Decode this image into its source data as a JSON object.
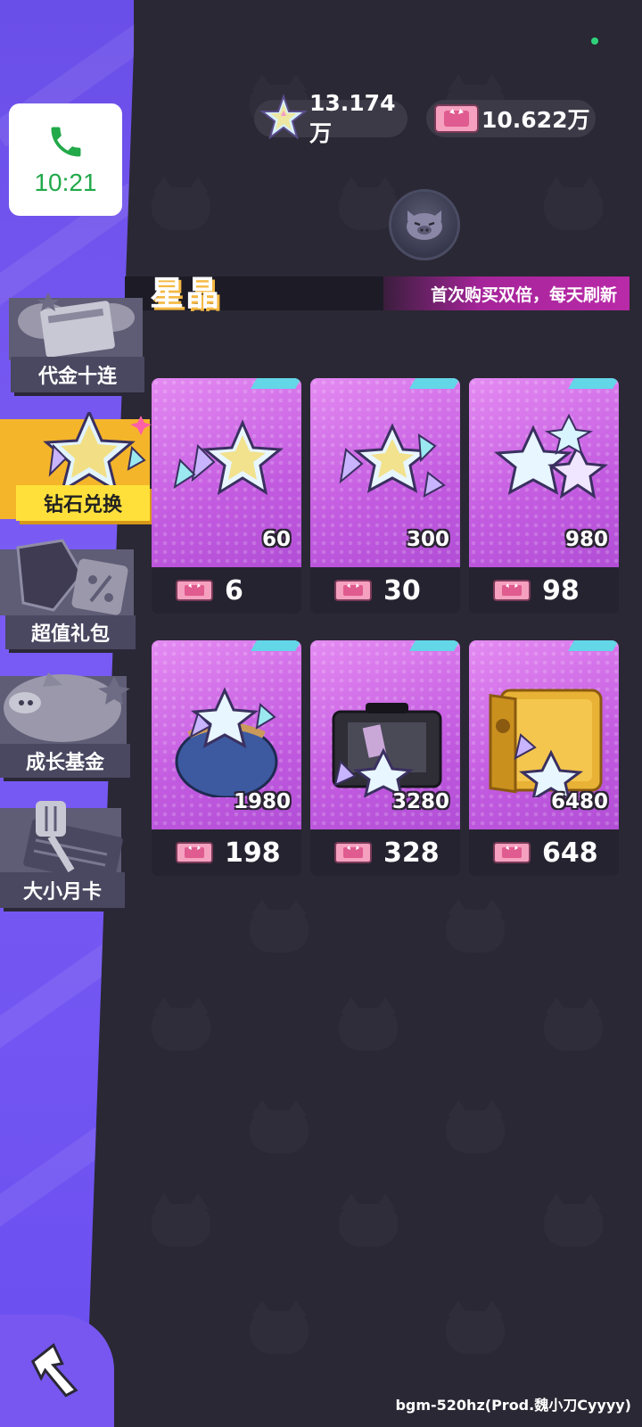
{
  "status": {
    "call_time": "10:21"
  },
  "currencies": {
    "star_crystal": "13.174万",
    "ticket": "10.622万"
  },
  "header": {
    "title": "星晶",
    "tagline": "首次购买双倍，每天刷新"
  },
  "menu": [
    {
      "label": "代金十连",
      "active": false,
      "icon": "coupon-stack-icon"
    },
    {
      "label": "钻石兑换",
      "active": true,
      "icon": "star-crystal-icon"
    },
    {
      "label": "超值礼包",
      "active": false,
      "icon": "gift-bag-icon"
    },
    {
      "label": "成长基金",
      "active": false,
      "icon": "piggy-bank-icon"
    },
    {
      "label": "大小月卡",
      "active": false,
      "icon": "spatula-card-icon"
    }
  ],
  "products": [
    {
      "amount": "60",
      "price": "6"
    },
    {
      "amount": "300",
      "price": "30"
    },
    {
      "amount": "980",
      "price": "98"
    },
    {
      "amount": "1980",
      "price": "198"
    },
    {
      "amount": "3280",
      "price": "328"
    },
    {
      "amount": "6480",
      "price": "648"
    }
  ],
  "footer": {
    "bgm": "bgm-520hz(Prod.魏小刀Cyyyy)"
  },
  "colors": {
    "background": "#2a2834",
    "sidebar": "#6a4ee8",
    "active_tab": "#ffe03a",
    "card_pink": "#d46fe8",
    "call_green": "#22a94a"
  }
}
